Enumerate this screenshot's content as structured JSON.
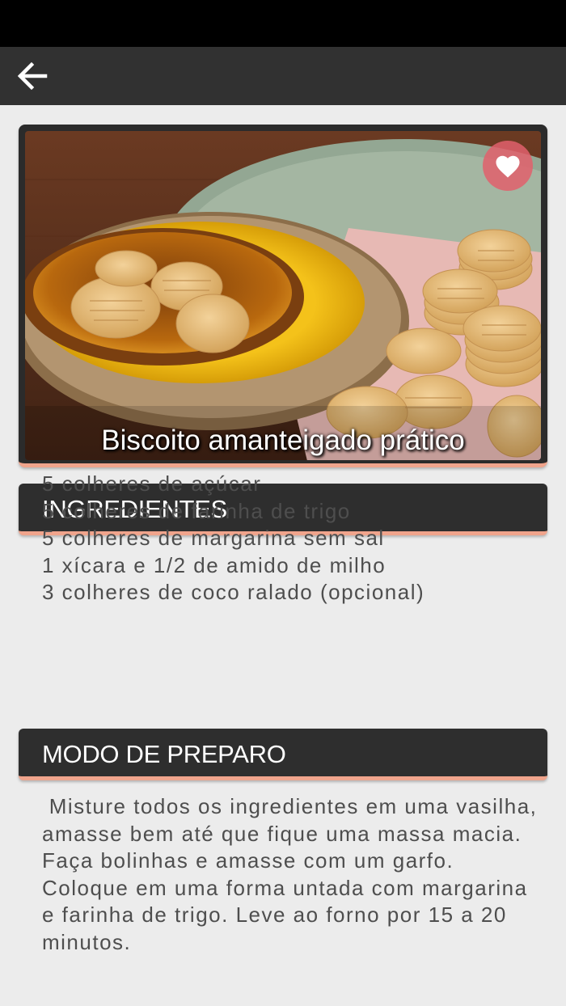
{
  "app_bar": {
    "back_icon": "arrow-left-icon"
  },
  "recipe": {
    "title": "Biscoito amanteigado prático",
    "favorite_icon": "heart-icon"
  },
  "ingredients": {
    "header": "INGREDIENTES",
    "items": [
      "5 colheres de açúcar",
      "5 colheres de farinha de trigo",
      "5 colheres de margarina sem sal",
      "1 xícara e 1/2 de amido de milho",
      "3 colheres de coco ralado (opcional)"
    ]
  },
  "preparation": {
    "header": "MODO DE PREPARO",
    "text": " Misture todos os ingredientes em uma vasilha, amasse bem até que fique uma massa macia. Faça bolinhas e amasse com um garfo. Coloque em uma forma untada com margarina e farinha de trigo. Leve ao forno por 15 a 20 minutos."
  },
  "colors": {
    "app_bar": "#313131",
    "status_bar": "#000000",
    "background": "#ececec",
    "accent": "#f0a48c",
    "favorite": "#e2606c",
    "text": "#4e4e4e"
  }
}
